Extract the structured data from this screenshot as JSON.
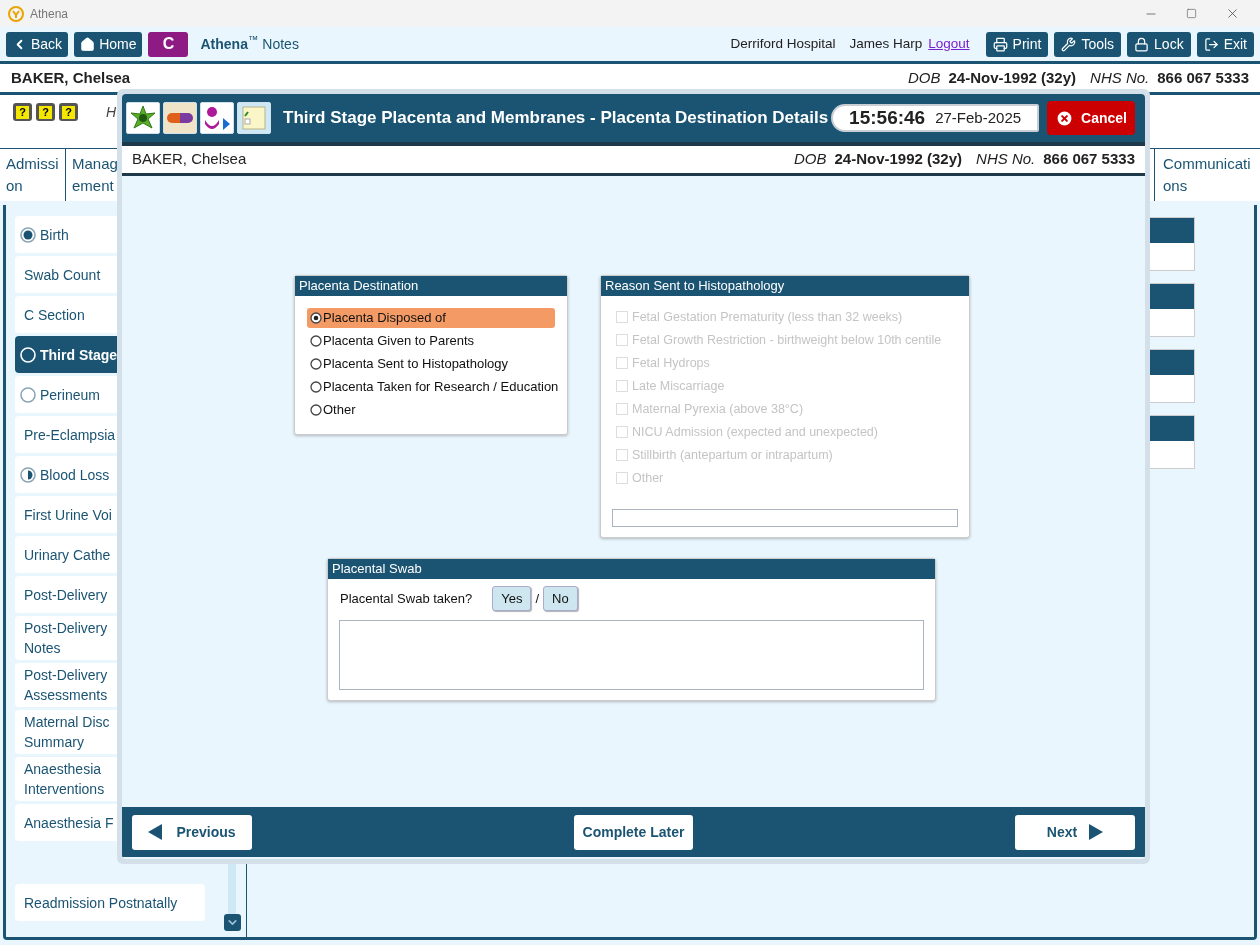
{
  "app": {
    "title": "Athena"
  },
  "toolbar": {
    "nav": [
      {
        "kind": "back",
        "label": "Back"
      },
      {
        "kind": "home",
        "label": "Home"
      }
    ],
    "badge": "C",
    "brand": "**Athena**$^{™}$ Notes",
    "site": "Derriford Hospital",
    "user": "James Harp",
    "logout": "Logout",
    "actions": [
      {
        "kind": "print",
        "label": "Print"
      },
      {
        "kind": "tools",
        "label": "Tools"
      },
      {
        "kind": "lock",
        "label": "Lock"
      },
      {
        "kind": "exit",
        "label": "Exit"
      }
    ]
  },
  "patient": {
    "name": "BAKER, Chelsea",
    "dob_label": "DOB",
    "dob": "24-Nov-1992 (32y)",
    "nhs_label": "NHS No.",
    "nhs": "866 067 5333"
  },
  "help_buttons": [
    "?",
    "?",
    "?"
  ],
  "hint": "H",
  "tabs": [
    {
      "label": "Admission"
    },
    {
      "label": "Management"
    },
    {
      "label": "Communications"
    }
  ],
  "sidebar": {
    "items": [
      {
        "label": "Birth",
        "kind": "complete",
        "selected": false
      },
      {
        "label": "Swab Count",
        "kind": "plain",
        "selected": false
      },
      {
        "label": "C Section",
        "kind": "plain",
        "selected": false
      },
      {
        "label": "Third Stage",
        "kind": "empty",
        "selected": true
      },
      {
        "label": "Perineum",
        "kind": "empty",
        "selected": false
      },
      {
        "label": "Pre-Eclampsia",
        "kind": "plain",
        "selected": false
      },
      {
        "label": "Blood Loss",
        "kind": "partial",
        "selected": false
      },
      {
        "label": "First Urine Voi",
        "kind": "plain",
        "selected": false
      },
      {
        "label": "Urinary Cathe",
        "kind": "plain",
        "selected": false
      },
      {
        "label": "Post-Delivery",
        "kind": "plain",
        "selected": false
      },
      {
        "label": "Post-Delivery\nNotes",
        "kind": "plain",
        "selected": false
      },
      {
        "label": "Post-Delivery\nAssessments",
        "kind": "plain",
        "selected": false
      },
      {
        "label": "Maternal Disc\nSummary",
        "kind": "plain",
        "selected": false
      },
      {
        "label": "Anaesthesia\nInterventions",
        "kind": "plain",
        "selected": false
      },
      {
        "label": "Anaesthesia F",
        "kind": "plain",
        "selected": false
      },
      {
        "label": "Readmission Postnatally",
        "kind": "plain",
        "selected": false,
        "gap_before": true
      }
    ]
  },
  "modal": {
    "title": "Third Stage Placenta and Membranes - Placenta Destination Details",
    "time": "15:56:46",
    "date": "27-Feb-2025",
    "cancel": "Cancel",
    "patient": {
      "name": "BAKER, Chelsea",
      "dob_label": "DOB",
      "dob": "24-Nov-1992 (32y)",
      "nhs_label": "NHS No.",
      "nhs": "866 067 5333"
    },
    "destination": {
      "title": "Placenta Destination",
      "options": [
        {
          "label": "Placenta Disposed of",
          "selected": true
        },
        {
          "label": "Placenta Given to Parents",
          "selected": false
        },
        {
          "label": "Placenta Sent to Histopathology",
          "selected": false
        },
        {
          "label": "Placenta Taken for Research / Education",
          "selected": false
        },
        {
          "label": "Other",
          "selected": false
        }
      ]
    },
    "reasons": {
      "title": "Reason Sent to Histopathology",
      "disabled": true,
      "options": [
        {
          "label": "Fetal Gestation Prematurity (less than 32 weeks)",
          "checked": false
        },
        {
          "label": "Fetal Growth Restriction - birthweight below 10th centile",
          "checked": false
        },
        {
          "label": "Fetal Hydrops",
          "checked": false
        },
        {
          "label": "Late Miscarriage",
          "checked": false
        },
        {
          "label": "Maternal Pyrexia (above 38°C)",
          "checked": false
        },
        {
          "label": "NICU Admission (expected and unexpected)",
          "checked": false
        },
        {
          "label": "Stillbirth (antepartum or intrapartum)",
          "checked": false
        },
        {
          "label": "Other",
          "checked": false
        }
      ]
    },
    "swab": {
      "title": "Placental Swab",
      "question": "Placental Swab taken?",
      "separator": "/",
      "answers": [
        {
          "label": "Yes",
          "selected": false
        },
        {
          "label": "No",
          "selected": false
        }
      ]
    },
    "footer": {
      "previous": "Previous",
      "complete_later": "Complete Later",
      "next": "Next"
    }
  }
}
